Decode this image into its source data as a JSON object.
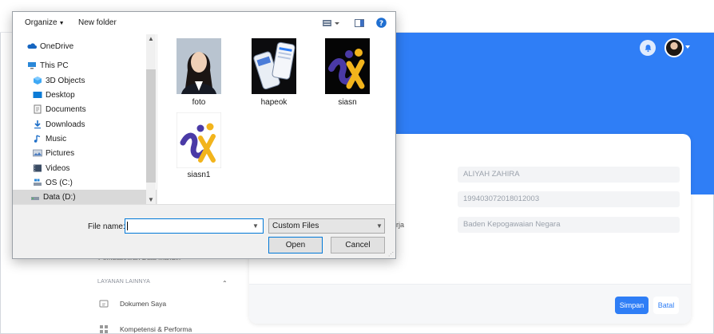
{
  "dialog": {
    "toolbar": {
      "organize": "Organize",
      "new_folder": "New folder"
    },
    "nav": [
      {
        "label": "OneDrive",
        "icon": "onedrive-icon"
      },
      {
        "label": "This PC",
        "icon": "pc-icon"
      },
      {
        "label": "3D Objects",
        "icon": "3d-objects-icon"
      },
      {
        "label": "Desktop",
        "icon": "desktop-icon"
      },
      {
        "label": "Documents",
        "icon": "documents-icon"
      },
      {
        "label": "Downloads",
        "icon": "downloads-icon"
      },
      {
        "label": "Music",
        "icon": "music-icon"
      },
      {
        "label": "Pictures",
        "icon": "pictures-icon"
      },
      {
        "label": "Videos",
        "icon": "videos-icon"
      },
      {
        "label": "OS (C:)",
        "icon": "drive-icon"
      },
      {
        "label": "Data (D:)",
        "icon": "drive-icon",
        "selected": true
      }
    ],
    "files": [
      {
        "name": "foto"
      },
      {
        "name": "hapeok"
      },
      {
        "name": "siasn"
      },
      {
        "name": "siasn1"
      }
    ],
    "file_name_label": "File name:",
    "file_name_value": "",
    "file_type": "Custom Files",
    "open_label": "Open",
    "cancel_label": "Cancel"
  },
  "form": {
    "name_value": "ALIYAH ZAHIRA",
    "nip_value": "199403072018012003",
    "unit_label_fragment": "rja",
    "unit_value": "Baden Kepogawaian Negara",
    "save_label": "Simpan",
    "cancel_label": "Batal"
  },
  "sidebar": {
    "fragment_item": "Pemutakhiran Data Mandiri",
    "section_label": "LAYANAN LAINNYA",
    "items": [
      {
        "label": "Dokumen Saya"
      },
      {
        "label": "Kompetensi & Performa"
      }
    ]
  },
  "colors": {
    "primary": "#2f7ef6",
    "selection": "#d9d9d9",
    "focus": "#0078d7"
  }
}
